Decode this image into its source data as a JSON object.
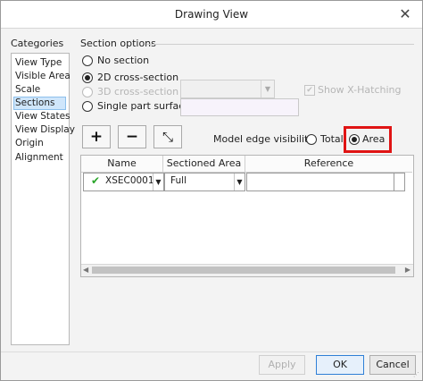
{
  "window": {
    "title": "Drawing View",
    "close_glyph": "✕"
  },
  "categories": {
    "label": "Categories",
    "items": [
      "View Type",
      "Visible Area",
      "Scale",
      "Sections",
      "View States",
      "View Display",
      "Origin",
      "Alignment"
    ],
    "selected": "Sections"
  },
  "section_options": {
    "title": "Section options",
    "no_section": "No section",
    "cross_2d": "2D cross-section",
    "cross_3d": "3D cross-section",
    "single_part": "Single part surface",
    "selected": "2D cross-section",
    "show_xhatch": "Show X-Hatching"
  },
  "toolbar": {
    "add_glyph": "+",
    "remove_glyph": "−",
    "flip_glyph": "⤡"
  },
  "model_edge": {
    "label": "Model edge visibility",
    "total": "Total",
    "area": "Area",
    "selected": "Area"
  },
  "table": {
    "headers": [
      "Name",
      "Sectioned Area",
      "Reference"
    ],
    "rows": [
      {
        "status": "✔",
        "name": "XSEC0001",
        "sectioned_area": "Full",
        "reference": ""
      }
    ]
  },
  "icons": {
    "dropdown": "▼",
    "scroll_left": "◀",
    "scroll_right": "▶",
    "check": "✔"
  },
  "colors": {
    "highlight": "#e01414",
    "selection": "#cfe6fb",
    "status_ok": "#2aa52a"
  },
  "footer": {
    "apply": "Apply",
    "ok": "OK",
    "cancel": "Cancel"
  }
}
